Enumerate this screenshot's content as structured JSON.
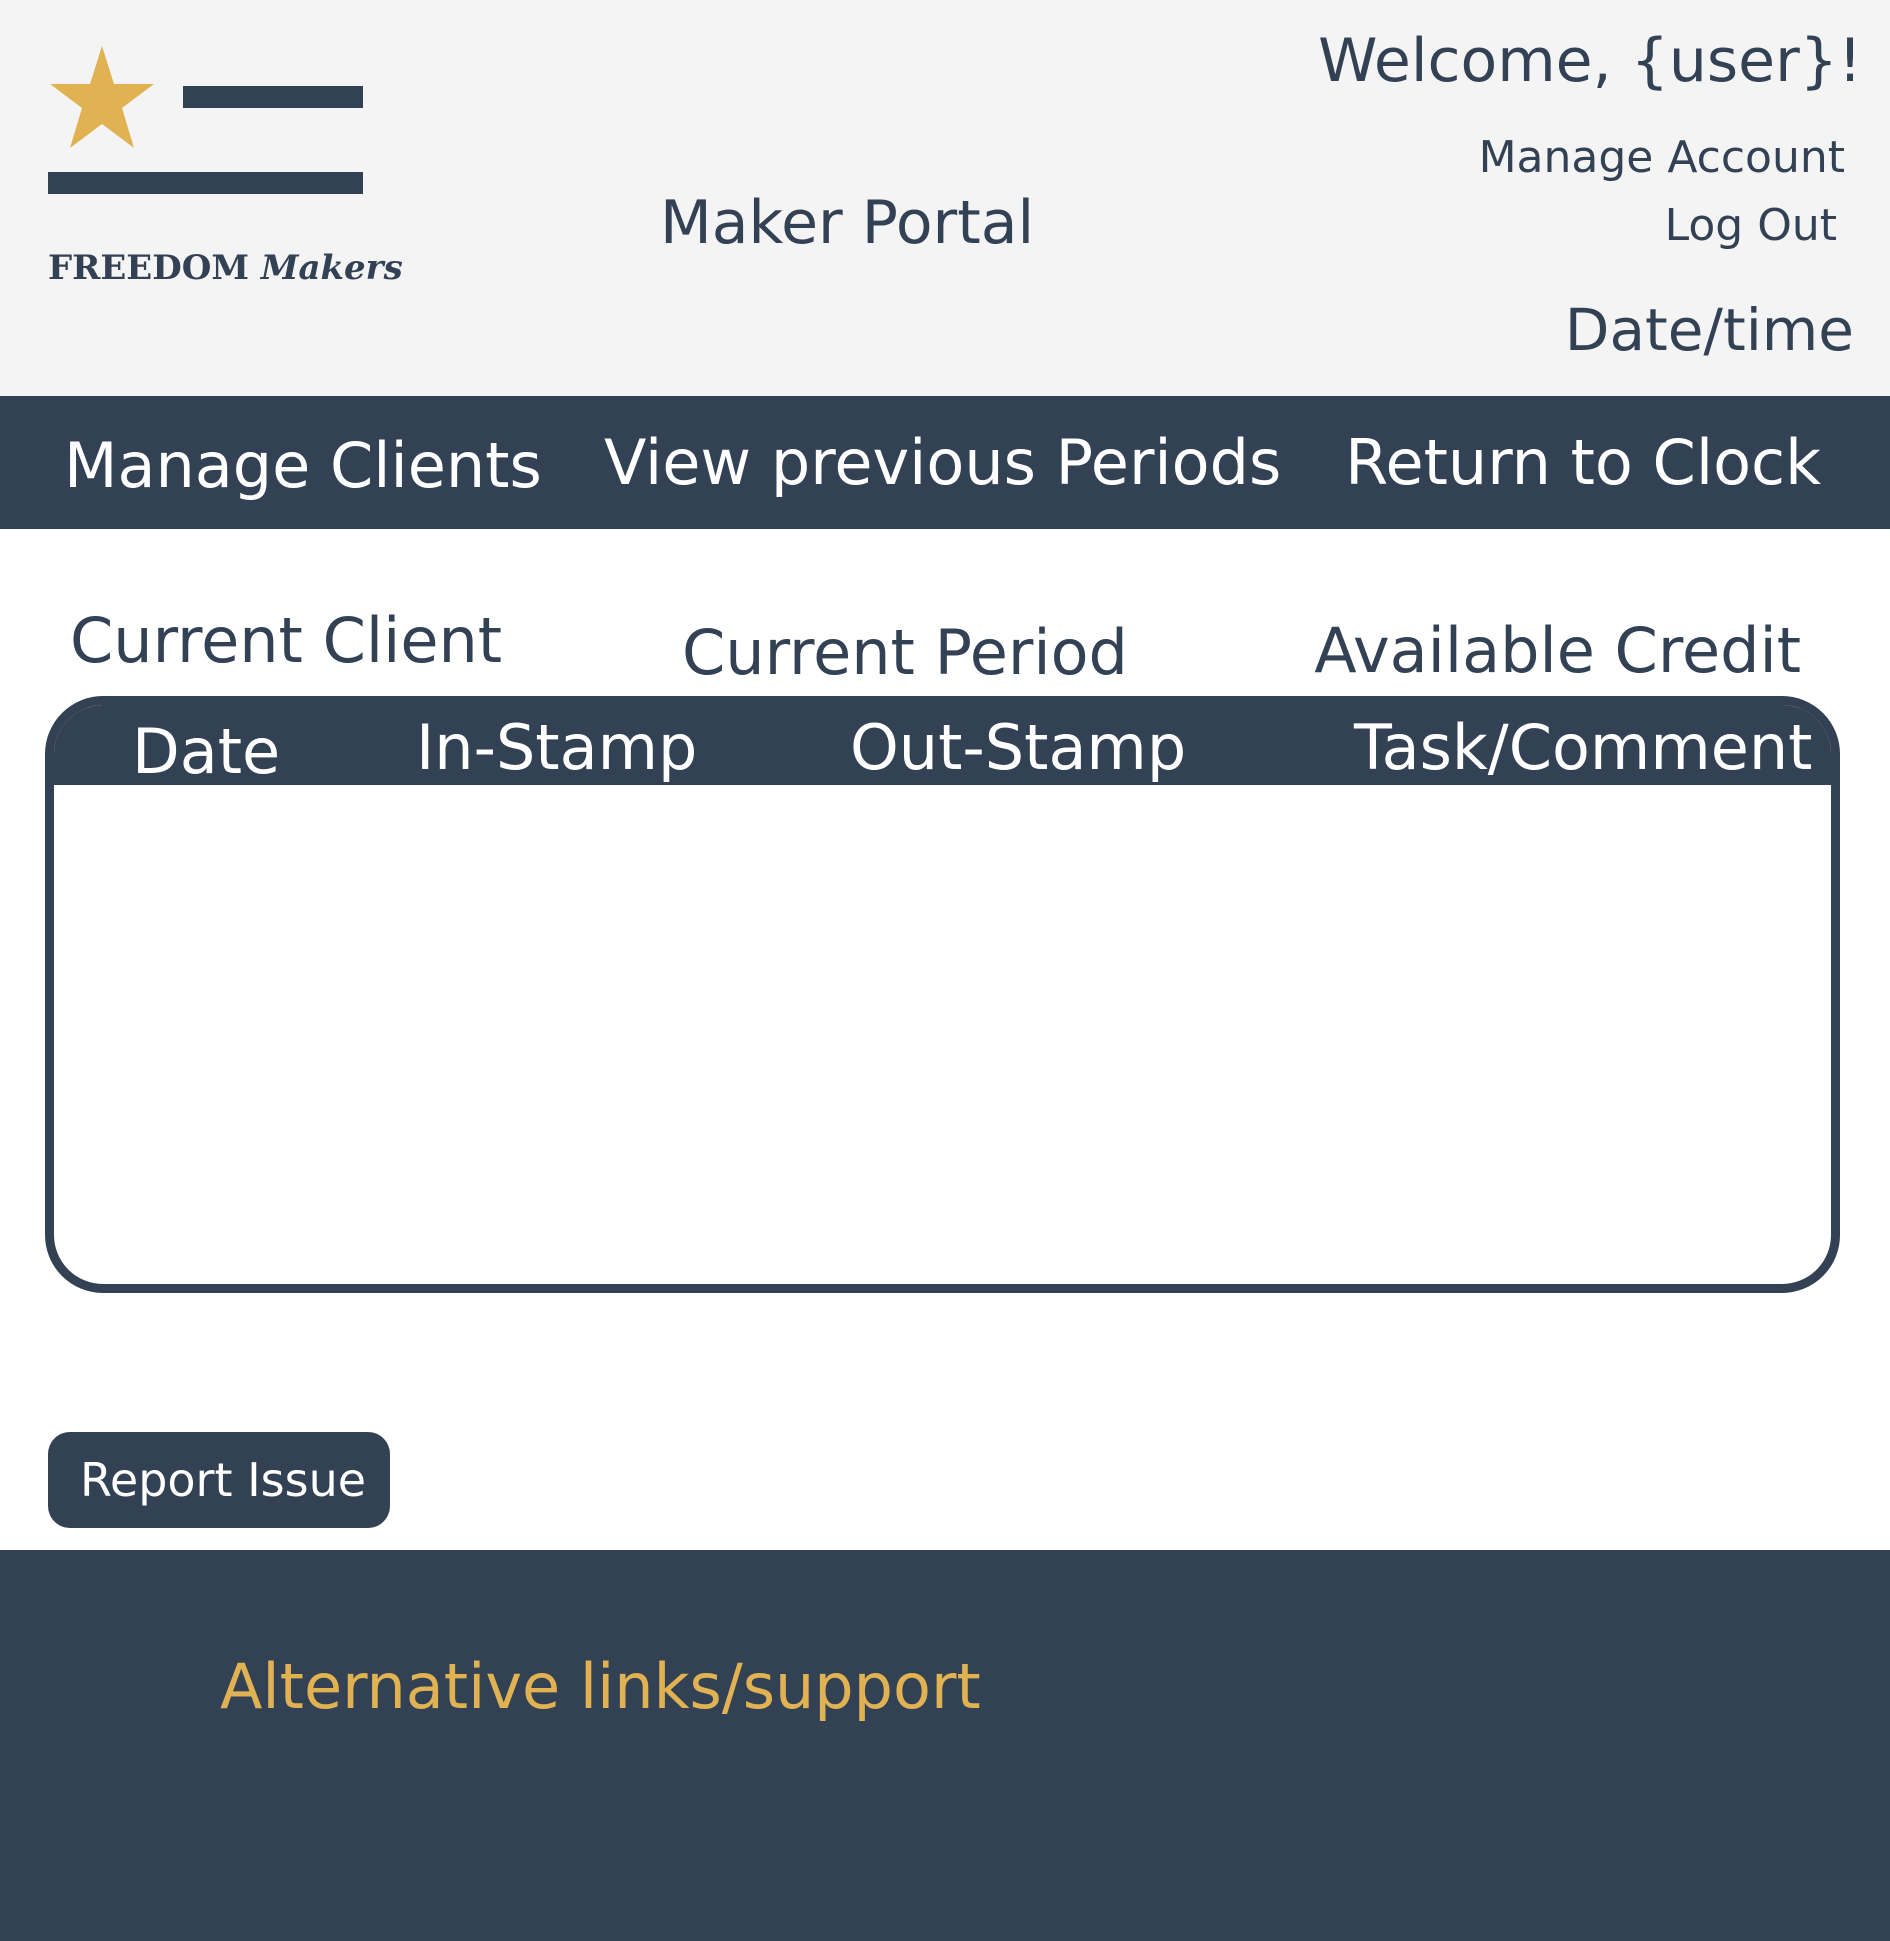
{
  "colors": {
    "primary": "#334155",
    "accent_gold": "#e0b252",
    "header_bg": "#f4f4f4",
    "text_on_dark": "#ffffff"
  },
  "logo": {
    "brand": "FREEDOM",
    "brand_suffix": "Makers",
    "icon": "star-icon"
  },
  "header": {
    "title": "Maker Portal",
    "welcome": "Welcome, {user}!",
    "manage_account": "Manage Account",
    "log_out": "Log Out",
    "datetime": "Date/time"
  },
  "nav": {
    "manage_clients": "Manage Clients",
    "view_previous_periods": "View previous Periods",
    "return_to_clock": "Return to Clock"
  },
  "info": {
    "current_client": "Current Client",
    "current_period": "Current Period",
    "available_credit": "Available Credit"
  },
  "table": {
    "columns": [
      "Date",
      "In-Stamp",
      "Out-Stamp",
      "Task/Comment"
    ],
    "rows": []
  },
  "actions": {
    "report_issue": "Report Issue"
  },
  "footer": {
    "link": "Alternative links/support"
  }
}
